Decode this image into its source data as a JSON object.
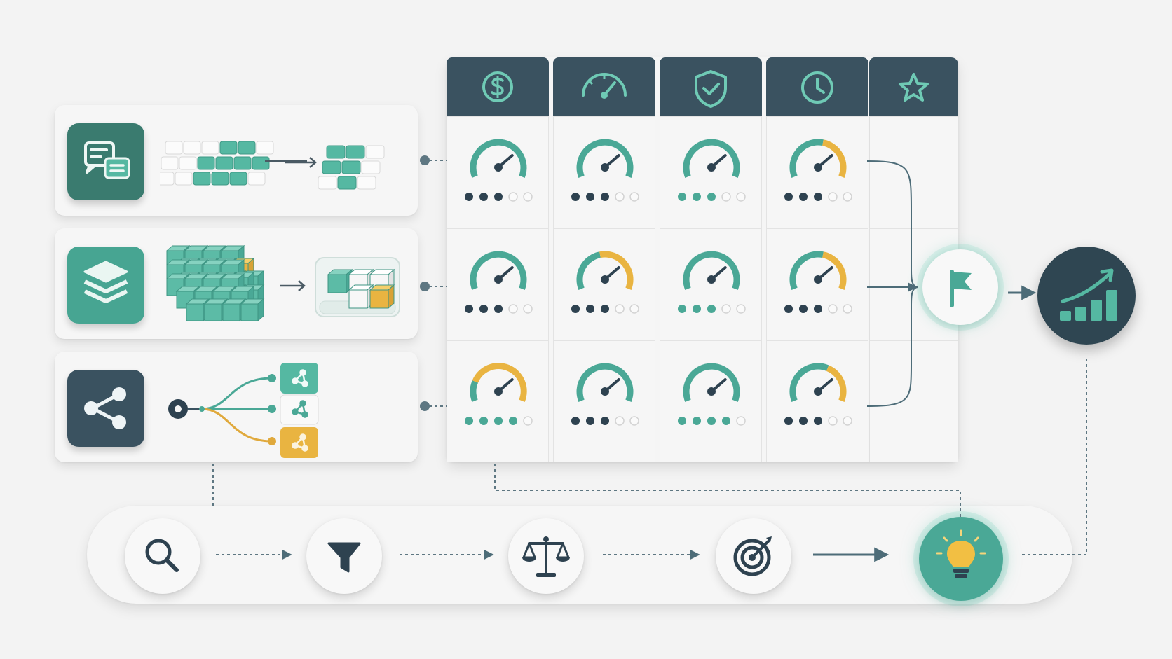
{
  "colors": {
    "teal": "#4aa896",
    "teal_light": "#7dc9b8",
    "navy": "#3a5260",
    "navy_dark": "#2e4250",
    "amber": "#e9b441",
    "card_bg": "#f6f6f6",
    "page_bg": "#f3f3f3"
  },
  "input_cards": [
    {
      "name": "text-data-card",
      "icon": "chat-icon",
      "kind": "token-grid"
    },
    {
      "name": "structured-data-card",
      "icon": "layers-icon",
      "kind": "cube-stack"
    },
    {
      "name": "graph-data-card",
      "icon": "share-icon",
      "kind": "branching"
    }
  ],
  "columns": [
    {
      "icon": "dollar-icon"
    },
    {
      "icon": "speedometer-icon"
    },
    {
      "icon": "shield-check-icon"
    },
    {
      "icon": "clock-icon"
    },
    {
      "icon": "star-icon"
    }
  ],
  "gauges": [
    [
      {
        "level": 0.72,
        "amber_from": null,
        "dots": 3,
        "dot_color": "navy"
      },
      {
        "level": 0.72,
        "amber_from": null,
        "dots": 3,
        "dot_color": "navy"
      },
      {
        "level": 0.72,
        "amber_from": null,
        "dots": 3,
        "dot_color": "teal"
      },
      {
        "level": 0.72,
        "amber_from": 0.55,
        "dots": 3,
        "dot_color": "navy"
      }
    ],
    [
      {
        "level": 0.72,
        "amber_from": null,
        "dots": 3,
        "dot_color": "navy"
      },
      {
        "level": 0.72,
        "amber_from": 0.45,
        "dots": 3,
        "dot_color": "navy"
      },
      {
        "level": 0.72,
        "amber_from": null,
        "dots": 3,
        "dot_color": "teal"
      },
      {
        "level": 0.72,
        "amber_from": 0.55,
        "dots": 3,
        "dot_color": "navy"
      }
    ],
    [
      {
        "level": 0.72,
        "amber_from": 0.2,
        "dots": 4,
        "dot_color": "teal"
      },
      {
        "level": 0.72,
        "amber_from": null,
        "dots": 3,
        "dot_color": "navy"
      },
      {
        "level": 0.72,
        "amber_from": null,
        "dots": 4,
        "dot_color": "teal"
      },
      {
        "level": 0.72,
        "amber_from": 0.6,
        "dots": 3,
        "dot_color": "navy"
      }
    ]
  ],
  "merge_node": {
    "icon": "flag-icon"
  },
  "result_node": {
    "icon": "growth-chart-icon"
  },
  "pipeline_steps": [
    {
      "icon": "search-icon"
    },
    {
      "icon": "filter-icon"
    },
    {
      "icon": "balance-scale-icon"
    },
    {
      "icon": "target-icon"
    },
    {
      "icon": "lightbulb-icon"
    }
  ]
}
